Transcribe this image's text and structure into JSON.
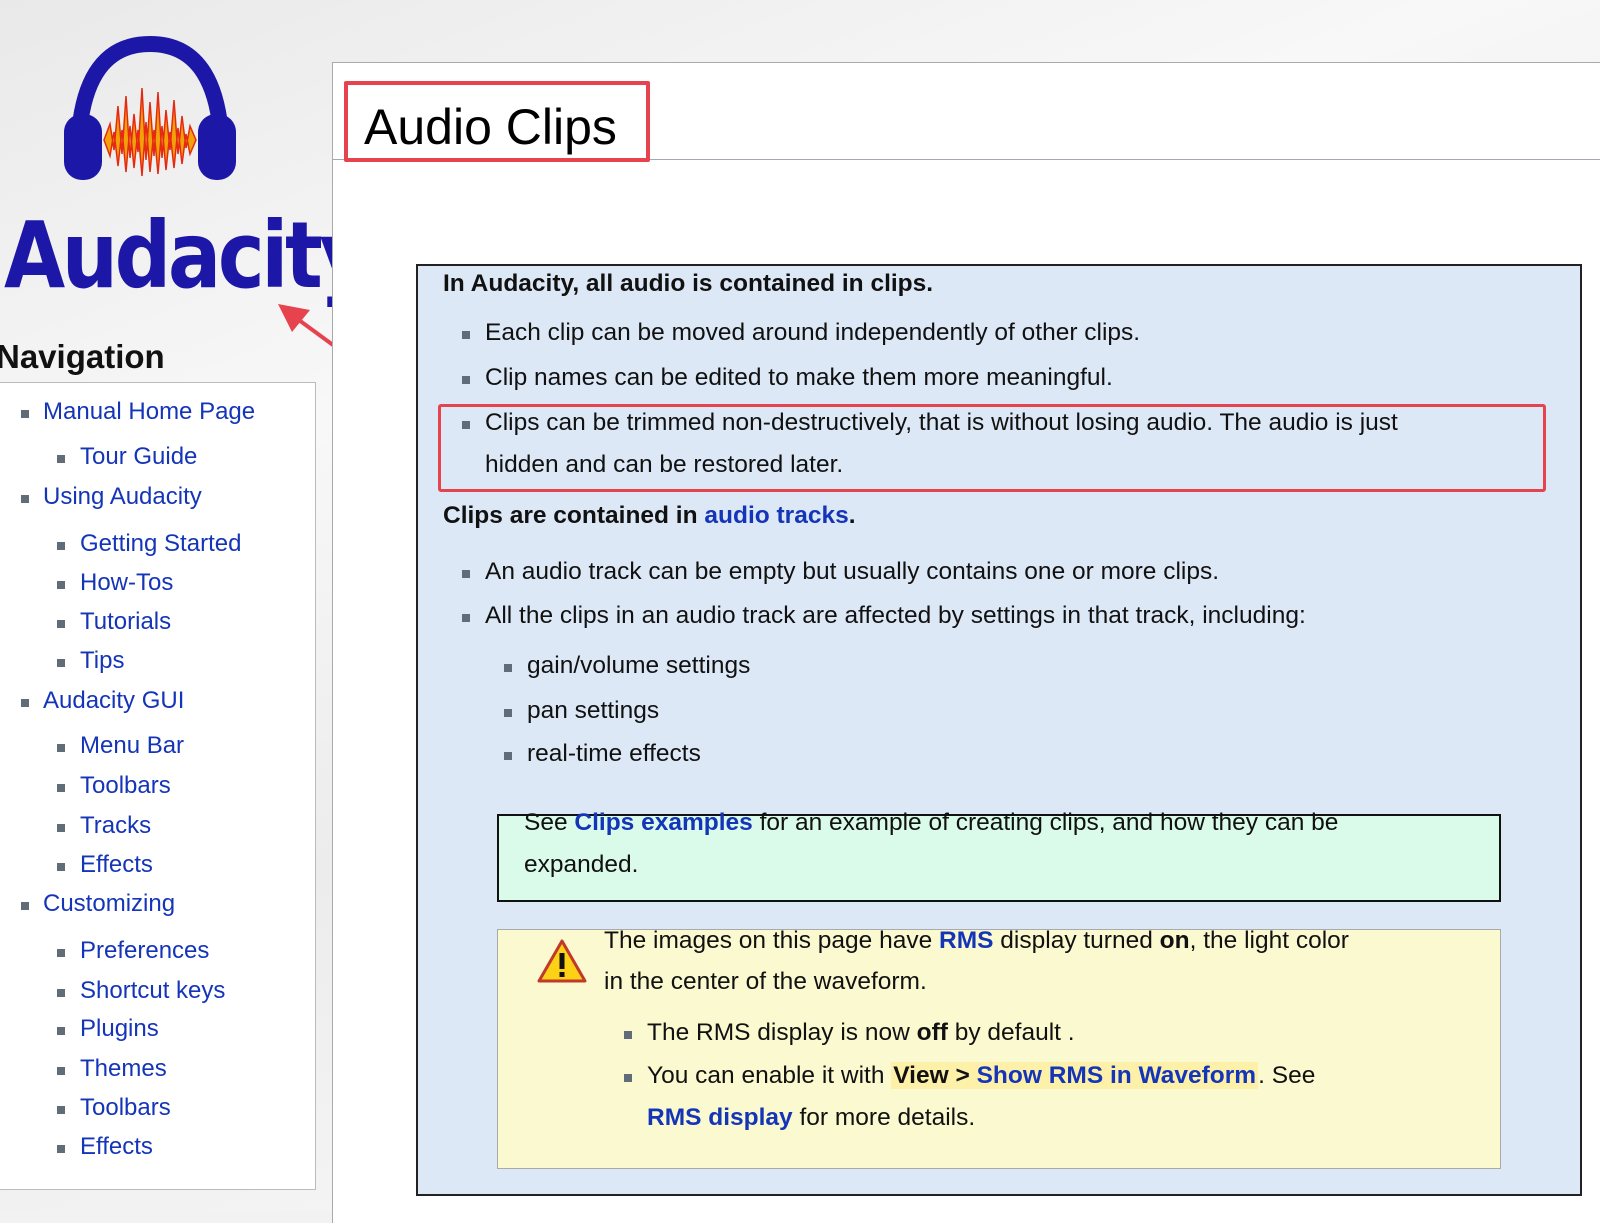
{
  "logo": {
    "text": "Audacity",
    "reg": "®"
  },
  "navigation": {
    "heading": "Navigation",
    "items": [
      {
        "label": "Manual Home Page",
        "level": 1
      },
      {
        "label": "Tour Guide",
        "level": 2
      },
      {
        "label": "Using Audacity",
        "level": 1
      },
      {
        "label": "Getting Started",
        "level": 2
      },
      {
        "label": "How-Tos",
        "level": 2
      },
      {
        "label": "Tutorials",
        "level": 2
      },
      {
        "label": "Tips",
        "level": 2
      },
      {
        "label": "Audacity GUI",
        "level": 1
      },
      {
        "label": "Menu Bar",
        "level": 2
      },
      {
        "label": "Toolbars",
        "level": 2
      },
      {
        "label": "Tracks",
        "level": 2
      },
      {
        "label": "Effects",
        "level": 2
      },
      {
        "label": "Customizing",
        "level": 1
      },
      {
        "label": "Preferences",
        "level": 2
      },
      {
        "label": "Shortcut keys",
        "level": 2
      },
      {
        "label": "Plugins",
        "level": 2
      },
      {
        "label": "Themes",
        "level": 2
      },
      {
        "label": "Toolbars",
        "level": 2
      },
      {
        "label": "Effects",
        "level": 2
      }
    ]
  },
  "page": {
    "title": "Audio Clips",
    "intro1": "In Audacity, all audio is contained in clips.",
    "clip_points": [
      "Each clip can be moved around independently of other clips.",
      "Clip names can be edited to make them more meaningful.",
      "Clips can be trimmed non-destructively, that is without losing audio. The audio is just",
      "hidden and can be restored later."
    ],
    "intro2_prefix": "Clips are contained in ",
    "intro2_link": "audio tracks",
    "intro2_suffix": ".",
    "track_points": [
      "An audio track can be empty but usually contains one or more clips.",
      "All the clips in an audio track are affected by settings in that track, including:"
    ],
    "track_settings": [
      "gain/volume settings",
      "pan settings",
      "real-time effects"
    ],
    "see_box": {
      "prefix": "See ",
      "link": "Clips examples",
      "suffix": " for an example of creating clips, and how they can be",
      "line2": "expanded."
    },
    "warning": {
      "line1_prefix": "The images on this page have ",
      "line1_link": "RMS",
      "line1_mid": " display turned ",
      "line1_bold": "on",
      "line1_suffix": ", the light color",
      "line2": "in the center of the waveform.",
      "bullet1_prefix": "The RMS display is now ",
      "bullet1_bold": "off",
      "bullet1_suffix": " by default .",
      "bullet2_prefix": "You can enable it with ",
      "bullet2_menu": "View > ",
      "bullet2_link": "Show RMS in Waveform",
      "bullet2_suffix": ". See",
      "bullet3_link": "RMS display",
      "bullet3_suffix": " for more details."
    }
  }
}
